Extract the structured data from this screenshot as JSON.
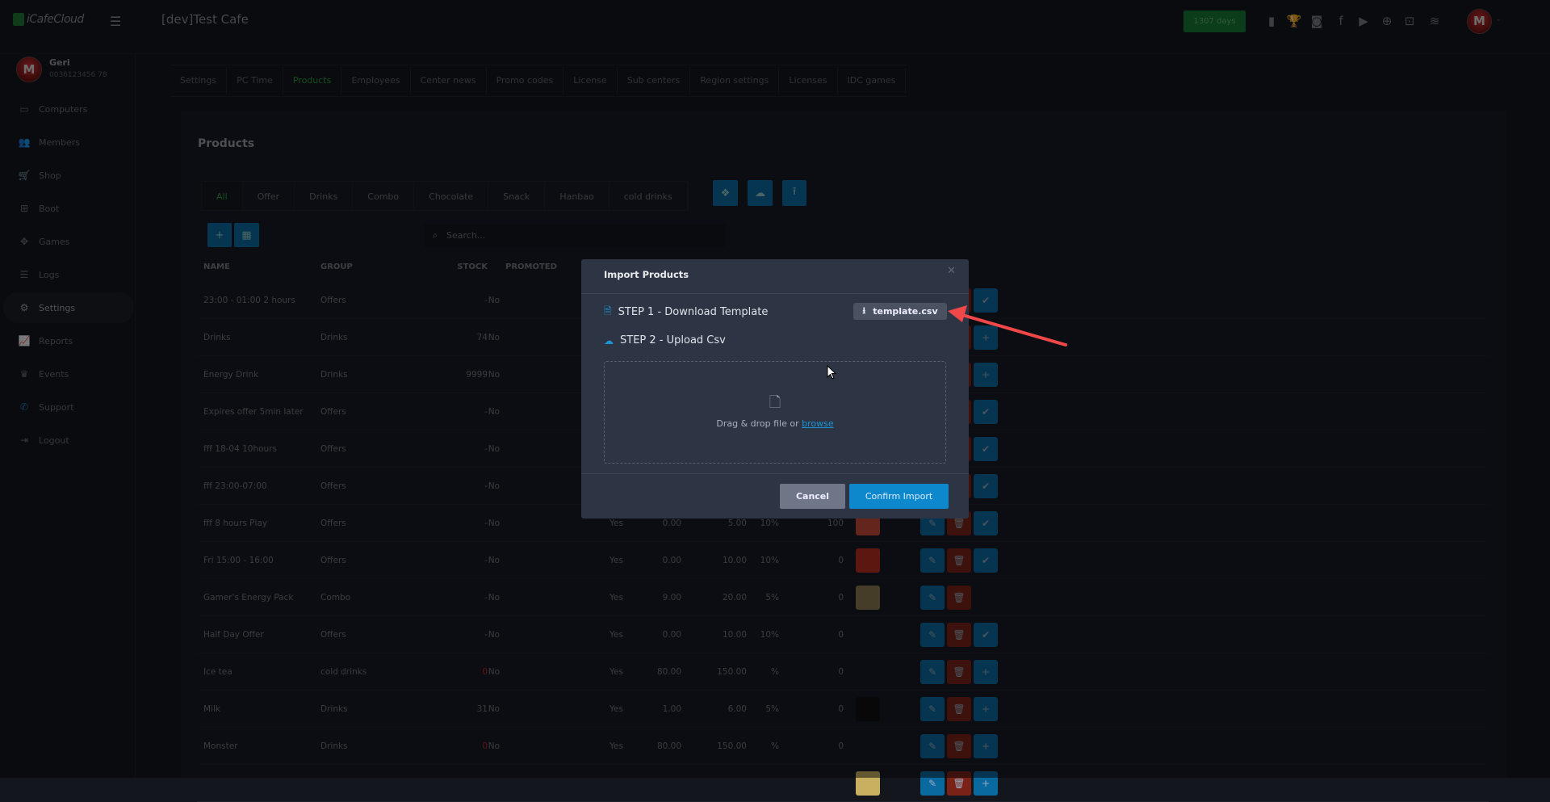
{
  "app": {
    "logo": "iCafeCloud",
    "cafe_name": "[dev]Test Cafe",
    "days_badge": "1307 days"
  },
  "header_icons": [
    "ranking-icon",
    "trophy-icon",
    "discord-icon",
    "facebook-icon",
    "youtube-icon",
    "globe-icon",
    "icafe-icon",
    "brand-icon"
  ],
  "user": {
    "name": "Geri",
    "phone": "0036123456 78"
  },
  "sidebar": {
    "items": [
      {
        "label": "Computers",
        "icon": "▭"
      },
      {
        "label": "Members",
        "icon": "👥"
      },
      {
        "label": "Shop",
        "icon": "🛒"
      },
      {
        "label": "Boot",
        "icon": "⊞"
      },
      {
        "label": "Games",
        "icon": "✥"
      },
      {
        "label": "Logs",
        "icon": "☰"
      },
      {
        "label": "Settings",
        "icon": "⚙",
        "active": true
      },
      {
        "label": "Reports",
        "icon": "📈"
      },
      {
        "label": "Events",
        "icon": "♛"
      },
      {
        "label": "Support",
        "icon": "✆"
      },
      {
        "label": "Logout",
        "icon": "⇥"
      }
    ]
  },
  "settings_tabs": [
    "Settings",
    "PC Time",
    "Products",
    "Employees",
    "Center news",
    "Promo codes",
    "License",
    "Sub centers",
    "Region settings",
    "Licenses",
    "IDC games"
  ],
  "active_settings_tab": "Products",
  "page_title": "Products",
  "categories": [
    "All",
    "Offer",
    "Drinks",
    "Combo",
    "Chocolate",
    "Snack",
    "Hanbao",
    "cold drinks"
  ],
  "search": {
    "placeholder": "Search..."
  },
  "table": {
    "headers": {
      "name": "NAME",
      "group": "GROUP",
      "stock": "STOCK",
      "promoted": "PROMOTED"
    },
    "rows": [
      {
        "name": "23:00 - 01:00 2 hours",
        "group": "Offers",
        "stock": "-",
        "promoted": "No",
        "last": "check"
      },
      {
        "name": "Drinks",
        "group": "Drinks",
        "stock": "74",
        "promoted": "No",
        "last": "plus"
      },
      {
        "name": "Energy Drink",
        "group": "Drinks",
        "stock": "9999",
        "promoted": "No",
        "last": "plus"
      },
      {
        "name": "Expires offer 5min later",
        "group": "Offers",
        "stock": "-",
        "promoted": "No",
        "last": "check"
      },
      {
        "name": "fff 18-04 10hours",
        "group": "Offers",
        "stock": "-",
        "promoted": "No",
        "last": "check"
      },
      {
        "name": "fff 23:00-07:00",
        "group": "Offers",
        "stock": "-",
        "promoted": "No",
        "last": "check"
      },
      {
        "name": "fff 8 hours Play",
        "group": "Offers",
        "stock": "-",
        "promoted": "No",
        "c5": "Yes",
        "c6": "0.00",
        "c7": "5.00",
        "c8": "10%",
        "c9": "100",
        "img": "#c84a3a",
        "last": "check"
      },
      {
        "name": "Fri 15:00 - 16:00",
        "group": "Offers",
        "stock": "-",
        "promoted": "No",
        "c5": "Yes",
        "c6": "0.00",
        "c7": "10.00",
        "c8": "10%",
        "c9": "0",
        "img": "#b83020",
        "last": "check"
      },
      {
        "name": "Gamer's Energy Pack",
        "group": "Combo",
        "stock": "-",
        "promoted": "No",
        "c5": "Yes",
        "c6": "9.00",
        "c7": "20.00",
        "c8": "5%",
        "c9": "0",
        "img": "#8a7a50",
        "last": ""
      },
      {
        "name": "Half Day Offer",
        "group": "Offers",
        "stock": "-",
        "promoted": "No",
        "c5": "Yes",
        "c6": "0.00",
        "c7": "10.00",
        "c8": "10%",
        "c9": "0",
        "last": "check"
      },
      {
        "name": "Ice tea",
        "group": "cold drinks",
        "stock": "0",
        "stock_red": true,
        "promoted": "No",
        "c5": "Yes",
        "c6": "80.00",
        "c7": "150.00",
        "c8": "%",
        "c9": "0",
        "last": "plus"
      },
      {
        "name": "Milk",
        "group": "Drinks",
        "stock": "31",
        "promoted": "No",
        "c5": "Yes",
        "c6": "1.00",
        "c7": "6.00",
        "c8": "5%",
        "c9": "0",
        "img": "#111",
        "last": "plus"
      },
      {
        "name": "Monster",
        "group": "Drinks",
        "stock": "0",
        "stock_red": true,
        "promoted": "No",
        "c5": "Yes",
        "c6": "80.00",
        "c7": "150.00",
        "c8": "%",
        "c9": "0",
        "last": "plus"
      },
      {
        "img": "#c8b060",
        "last": "plus"
      }
    ]
  },
  "modal": {
    "title": "Import Products",
    "step1": "STEP 1 - Download Template",
    "template_button": "template.csv",
    "step2": "STEP 2 - Upload Csv",
    "drop_text": "Drag & drop file or ",
    "browse_link": "browse",
    "cancel": "Cancel",
    "confirm": "Confirm Import"
  },
  "colors": {
    "accent": "#0e88cc",
    "success": "#167a34",
    "danger": "#7a2218",
    "annotation_arrow": "#f04848"
  }
}
